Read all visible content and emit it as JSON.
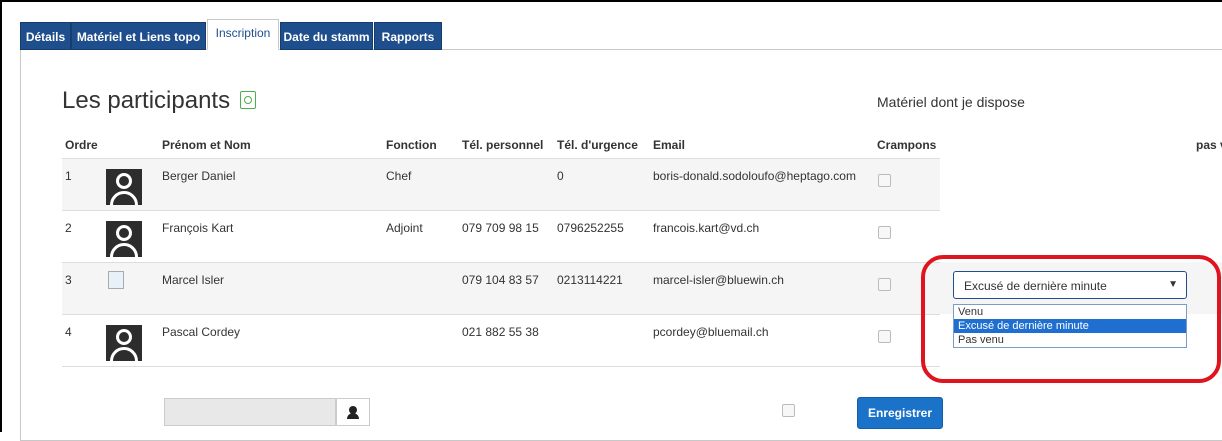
{
  "tabs": [
    {
      "label": "Détails"
    },
    {
      "label": "Matériel et Liens topo"
    },
    {
      "label": "Inscription"
    },
    {
      "label": "Date du stamm"
    },
    {
      "label": "Rapports"
    }
  ],
  "page": {
    "title": "Les participants",
    "materiel_title": "Matériel dont je dispose"
  },
  "table": {
    "headers": {
      "ordre": "Ordre",
      "nom": "Prénom et Nom",
      "fonction": "Fonction",
      "tel_perso": "Tél. personnel",
      "tel_urgence": "Tél. d'urgence",
      "email": "Email",
      "crampons": "Crampons",
      "pas": "pas v"
    },
    "rows": [
      {
        "ordre": "1",
        "nom": "Berger Daniel",
        "fonction": "Chef",
        "tel_perso": "",
        "tel_urgence": "0",
        "email": "boris-donald.sodoloufo@heptago.com"
      },
      {
        "ordre": "2",
        "nom": "François Kart",
        "fonction": "Adjoint",
        "tel_perso": "079 709 98 15",
        "tel_urgence": "0796252255",
        "email": "francois.kart@vd.ch"
      },
      {
        "ordre": "3",
        "nom": "Marcel Isler",
        "fonction": "",
        "tel_perso": "079 104 83 57",
        "tel_urgence": "0213114221",
        "email": "marcel-isler@bluewin.ch"
      },
      {
        "ordre": "4",
        "nom": "Pascal Cordey",
        "fonction": "",
        "tel_perso": "021 882 55 38",
        "tel_urgence": "",
        "email": "pcordey@bluemail.ch"
      }
    ]
  },
  "attendance_select": {
    "value": "Excusé de dernière minute",
    "options": [
      "Venu",
      "Excusé de dernière minute",
      "Pas venu"
    ],
    "selected_index": 1
  },
  "footer": {
    "save_label": "Enregistrer",
    "search_value": ""
  },
  "colors": {
    "tab_bg": "#1f4e8c",
    "save_btn": "#1a72c9",
    "highlight": "#e0141e"
  },
  "icons": {
    "export": "spreadsheet-export-icon",
    "user": "user-icon",
    "avatar": "avatar-placeholder-icon"
  }
}
